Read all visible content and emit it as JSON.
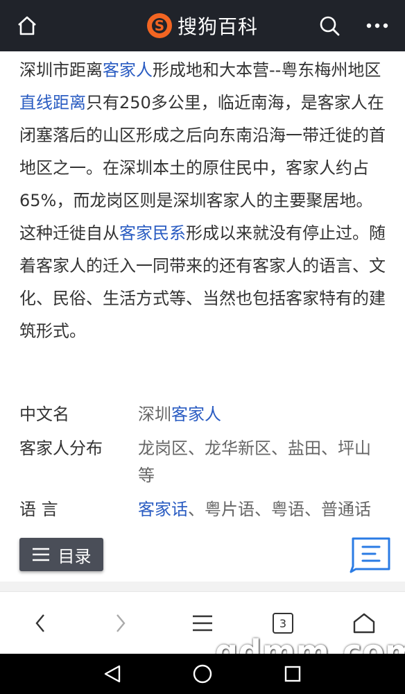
{
  "header": {
    "brand_name": "搜狗百科",
    "icons": {
      "home": "home-icon",
      "logo": "sogou-logo-icon",
      "search": "search-icon",
      "more": "more-dots-icon"
    }
  },
  "article": {
    "segments": [
      {
        "text": "深圳市距离",
        "link": false
      },
      {
        "text": "客家人",
        "link": true
      },
      {
        "text": "形成地和大本营--粤东梅州地区",
        "link": false
      },
      {
        "text": "直线距离",
        "link": true
      },
      {
        "text": "只有250多公里，临近南海，是客家人在闭塞落后的山区形成之后向东南沿海一带迁徙的首地区之一。在深圳本土的原住民中，客家人约占65%，而龙岗区则是深圳客家人的主要聚居地。这种迁徙自",
        "link": false
      },
      {
        "text": "从",
        "link": false
      },
      {
        "text": "客家民系",
        "link": true
      },
      {
        "text": "形成以来就没有停止过。随着客家人的迁入一同带来的还有客家人的语言、文化、民俗、生活方式等、当然也包括客家特有的建筑形式。",
        "link": false
      }
    ]
  },
  "infobox": {
    "rows": [
      {
        "key": "中文名",
        "value_prefix": "深圳",
        "value_link": "客家人",
        "value_suffix": ""
      },
      {
        "key": "客家人分布",
        "value_prefix": "龙岗区、龙华新区、盐田、坪山等",
        "value_link": "",
        "value_suffix": ""
      },
      {
        "key": "语 言",
        "value_prefix": "",
        "value_link": "客家话",
        "value_suffix": "、粤片语、粤语、普通话"
      }
    ]
  },
  "toc": {
    "label": "目录",
    "icon": "list-icon"
  },
  "edit": {
    "icon": "edit-note-icon"
  },
  "browser_bar": {
    "tab_count": "3",
    "icons": {
      "back": "chevron-left-icon",
      "forward": "chevron-right-icon",
      "menu": "hamburger-icon",
      "tabs": "tabs-icon",
      "home": "home-outline-icon"
    }
  },
  "watermark": "gdmm.com",
  "android_nav": {
    "icons": {
      "back": "triangle-back-icon",
      "home": "circle-home-icon",
      "recent": "square-recent-icon"
    }
  },
  "colors": {
    "header_bg": "#20232a",
    "link": "#2a5cc2",
    "logo_orange": "#f26522",
    "toc_bg": "#4a4e58",
    "edit_blue": "#2a7be4"
  }
}
